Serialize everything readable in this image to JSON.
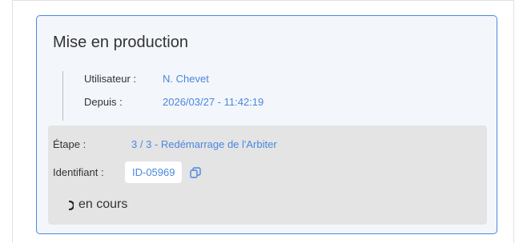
{
  "card": {
    "title": "Mise en production",
    "user_label": "Utilisateur :",
    "user_value": "N. Chevet",
    "since_label": "Depuis :",
    "since_value": "2026/03/27 - 11:42:19"
  },
  "step": {
    "label": "Étape :",
    "value": "3 / 3 - Redémarrage de l'Arbiter",
    "id_label": "Identifiant :",
    "id_value": "ID-05969",
    "status": "en cours"
  },
  "colors": {
    "accent": "#4a87df",
    "panel": "#e4e4e4",
    "card_bg": "#f3f6fb"
  },
  "icons": {
    "copy": "copy-icon",
    "spinner": "spinner-icon"
  }
}
